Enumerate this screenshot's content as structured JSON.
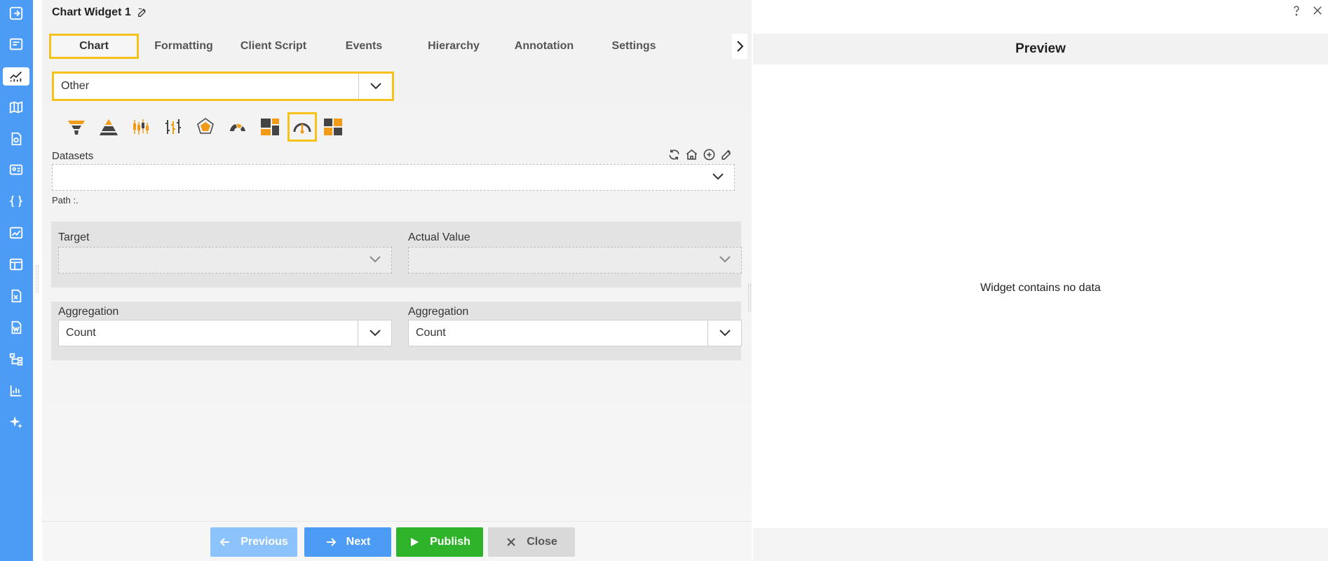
{
  "window": {
    "title": "Chart Widget 1"
  },
  "colors": {
    "rail": "#4c9bf5",
    "highlight": "#f4c21a",
    "publish": "#2fb32a",
    "chart_orange": "#f29b18",
    "chart_dark": "#444444"
  },
  "sidebar": {
    "items": [
      {
        "icon": "exit-icon"
      },
      {
        "icon": "list-icon"
      },
      {
        "icon": "chart-icon",
        "active": true
      },
      {
        "icon": "map-icon"
      },
      {
        "icon": "report-icon"
      },
      {
        "icon": "user-card-icon"
      },
      {
        "icon": "braces-icon"
      },
      {
        "icon": "image-chart-icon"
      },
      {
        "icon": "table-icon"
      },
      {
        "icon": "excel-icon"
      },
      {
        "icon": "word-icon"
      },
      {
        "icon": "hierarchy-icon"
      },
      {
        "icon": "bar-chart-icon"
      },
      {
        "icon": "sparkle-icon"
      }
    ]
  },
  "tabs": [
    {
      "label": "Chart",
      "active": true
    },
    {
      "label": "Formatting"
    },
    {
      "label": "Client Script"
    },
    {
      "label": "Events"
    },
    {
      "label": "Hierarchy"
    },
    {
      "label": "Annotation"
    },
    {
      "label": "Settings"
    }
  ],
  "chart_category": {
    "value": "Other"
  },
  "chart_types": [
    {
      "icon": "funnel-icon"
    },
    {
      "icon": "pyramid-icon"
    },
    {
      "icon": "candlestick-icon"
    },
    {
      "icon": "ohlc-icon"
    },
    {
      "icon": "radar-icon"
    },
    {
      "icon": "half-gauge-icon"
    },
    {
      "icon": "treemap-icon"
    },
    {
      "icon": "gauge-icon",
      "selected": true
    },
    {
      "icon": "heatmap-icon"
    }
  ],
  "datasets": {
    "label": "Datasets",
    "value": "",
    "path": "Path :."
  },
  "fields": {
    "target_label": "Target",
    "actual_label": "Actual Value",
    "agg1_label": "Aggregation",
    "agg1_value": "Count",
    "agg2_label": "Aggregation",
    "agg2_value": "Count"
  },
  "buttons": {
    "previous": "Previous",
    "next": "Next",
    "publish": "Publish",
    "close": "Close"
  },
  "preview": {
    "title": "Preview",
    "empty_message": "Widget contains no data"
  }
}
